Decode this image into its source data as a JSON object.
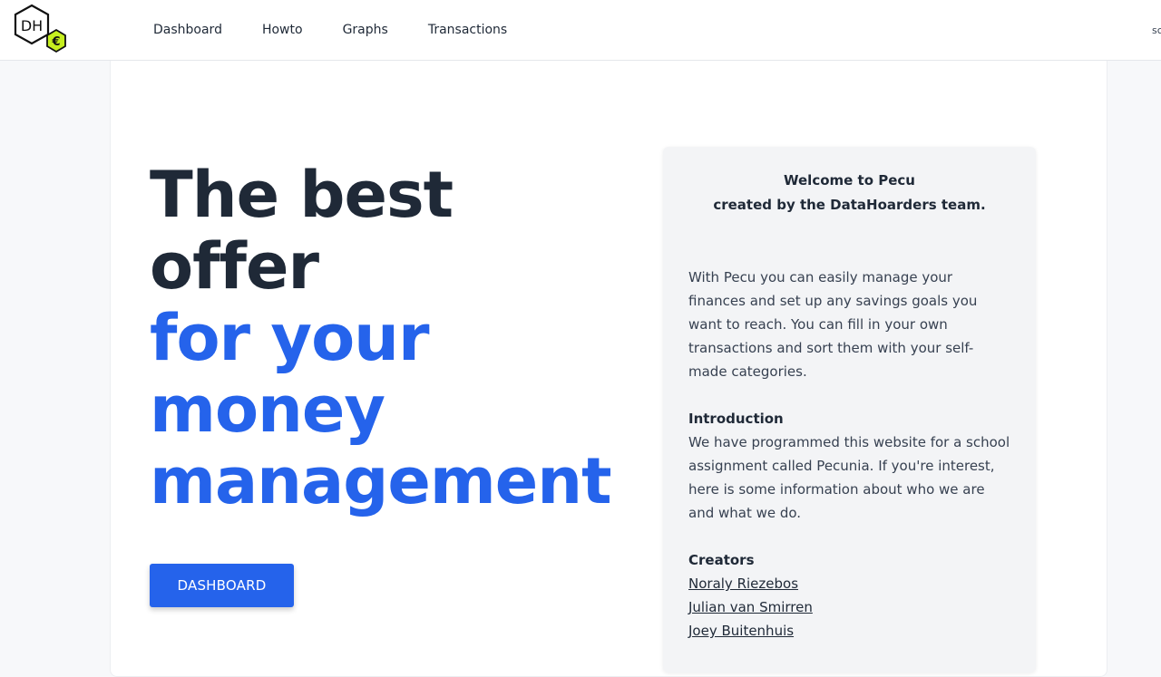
{
  "logo": {
    "text": "DH",
    "badge": "€"
  },
  "nav": {
    "items": [
      "Dashboard",
      "Howto",
      "Graphs",
      "Transactions"
    ],
    "cut_text": "sc"
  },
  "hero": {
    "line1": "The best",
    "line2": "offer",
    "line3": "for your",
    "line4": "money",
    "line5": "management",
    "button": "DASHBOARD"
  },
  "info": {
    "welcome1": "Welcome to Pecu",
    "welcome2": "created by the DataHoarders team.",
    "paragraph": "With Pecu you can easily manage your finances and set up any savings goals you want to reach. You can fill in your own transactions and sort them with your self-made categories.",
    "intro_title": "Introduction",
    "intro_text": "We have programmed this website for a school assignment called Pecunia. If you're interest, here is some information about who we are and what we do.",
    "creators_title": "Creators",
    "creators": [
      "Noraly Riezebos",
      "Julian van Smirren",
      "Joey Buitenhuis"
    ]
  },
  "colors": {
    "accent": "#2563eb",
    "logo_green": "#c6ef1f",
    "dark_text": "#1f2937"
  }
}
